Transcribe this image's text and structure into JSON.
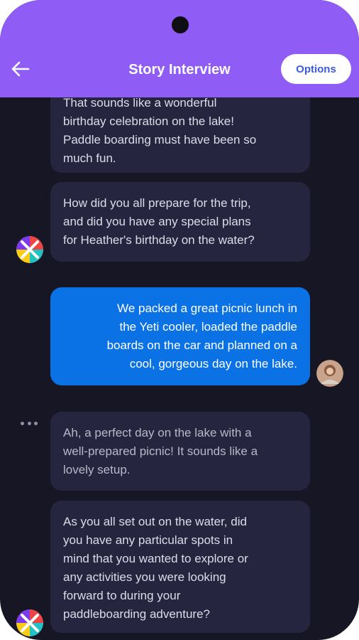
{
  "header": {
    "title": "Story Interview",
    "options_label": "Options",
    "accent_color": "#8f5cf6",
    "back_icon": "arrow-left-icon"
  },
  "messages": [
    {
      "role": "assistant",
      "text": "That sounds like a wonderful\nbirthday celebration on the lake!\nPaddle boarding must have been so\nmuch fun."
    },
    {
      "role": "assistant",
      "text": "How did you all prepare for the trip,\nand did you have any special plans\nfor Heather's birthday on the water?"
    },
    {
      "role": "user",
      "text": "We packed a great picnic lunch in\nthe Yeti cooler, loaded the paddle\nboards on the car and planned on a\ncool, gorgeous day on the lake."
    },
    {
      "role": "assistant",
      "text": "Ah, a perfect day on the lake with a\nwell-prepared picnic! It sounds like a\nlovely setup."
    },
    {
      "role": "assistant",
      "text": "As you all set out on the water, did\nyou have any particular spots in\nmind that you wanted to explore or\nany activities you were looking\nforward to during your\npaddleboarding adventure?"
    }
  ],
  "colors": {
    "background": "#171625",
    "assistant_bubble": "#262540",
    "user_bubble": "#0b72e6"
  },
  "icons": {
    "assistant_avatar": "multicolor-logo-avatar",
    "user_avatar": "user-photo-avatar",
    "typing": "typing-dots-icon"
  }
}
